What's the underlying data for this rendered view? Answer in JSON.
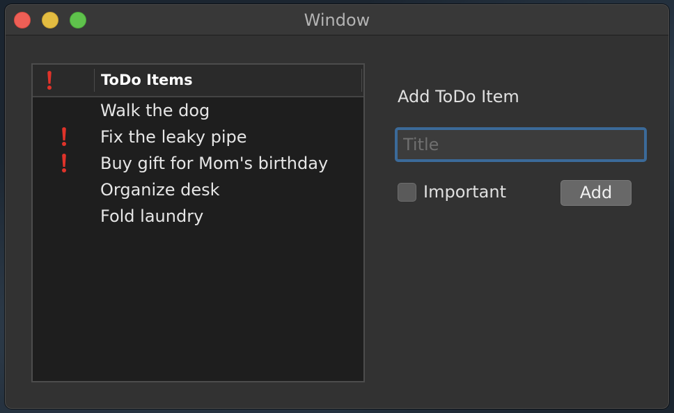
{
  "window": {
    "title": "Window"
  },
  "table": {
    "header": {
      "flag_icon": "exclamation-icon",
      "title": "ToDo Items"
    },
    "rows": [
      {
        "label": "Walk the dog",
        "important": false
      },
      {
        "label": "Fix the leaky pipe",
        "important": true
      },
      {
        "label": "Buy gift for Mom's birthday",
        "important": true
      },
      {
        "label": "Organize desk",
        "important": false
      },
      {
        "label": "Fold laundry",
        "important": false
      }
    ]
  },
  "form": {
    "heading": "Add ToDo Item",
    "title_placeholder": "Title",
    "title_value": "",
    "important_label": "Important",
    "important_checked": false,
    "add_label": "Add"
  },
  "colors": {
    "accent_focus": "#3b6a99",
    "important_flag": "#e0332a"
  }
}
